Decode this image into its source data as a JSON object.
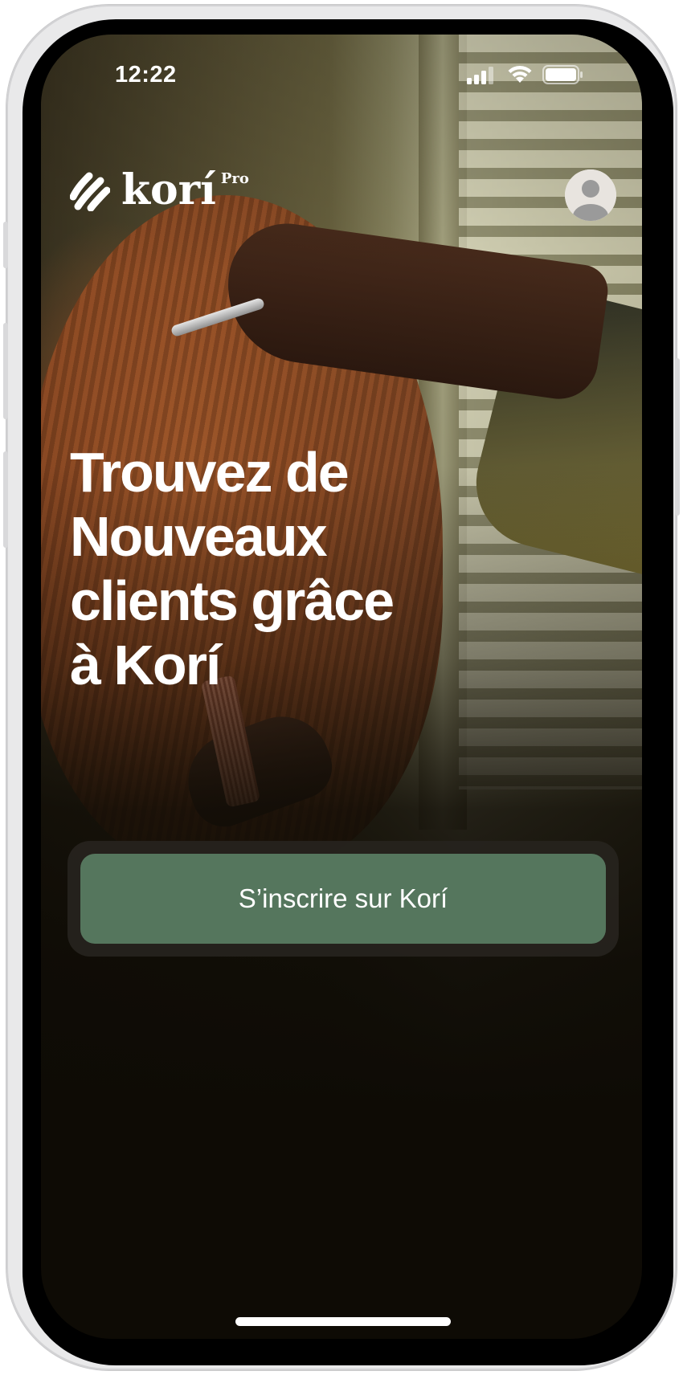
{
  "status_bar": {
    "time": "12:22"
  },
  "header": {
    "logo_text": "korí",
    "logo_badge": "Pro",
    "profile_icon": "user-avatar-icon"
  },
  "hero": {
    "headline_lines": [
      "Trouvez de",
      "Nouveaux",
      "clients grâce",
      "à Korí"
    ]
  },
  "cta": {
    "signup_label": "S’inscrire sur Korí"
  },
  "colors": {
    "cta_background": "#55765d",
    "cta_well": "#26231e",
    "screen_background": "#0e0b05",
    "text": "#ffffff"
  }
}
